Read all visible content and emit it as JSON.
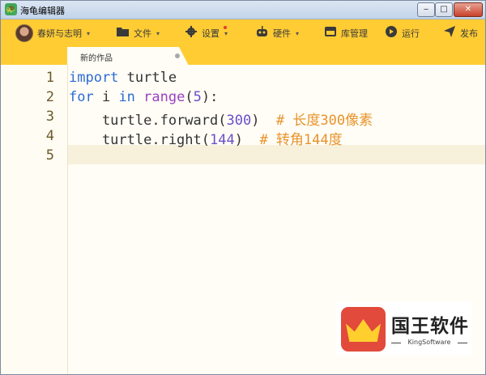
{
  "window": {
    "title": "海龟编辑器",
    "app_icon": "turtle-icon",
    "min_label": "‒",
    "max_label": "□",
    "close_label": "✕"
  },
  "toolbar": {
    "user_name": "春妍与志明",
    "file_label": "文件",
    "settings_label": "设置",
    "hardware_label": "硬件",
    "library_label": "库管理",
    "run_label": "运行",
    "publish_label": "发布",
    "caret": "▾",
    "icons": {
      "file": "folder-icon",
      "settings": "gear-icon",
      "hardware": "robot-icon",
      "library": "package-icon",
      "run": "play-icon",
      "publish": "send-icon"
    },
    "accent_color": "#ffcc33"
  },
  "tabs": [
    {
      "label": "新的作品"
    }
  ],
  "editor": {
    "line_numbers": [
      "1",
      "2",
      "3",
      "4",
      "5"
    ],
    "lines": [
      {
        "t1": "import",
        "t2": " turtle"
      },
      {
        "t1": "for",
        "t2": " i ",
        "t3": "in",
        "t4": " ",
        "t5": "range",
        "t6": "(",
        "t7": "5",
        "t8": "):"
      },
      {
        "t1": "    turtle.forward(",
        "t2": "300",
        "t3": ")  ",
        "t4": "# 长度300像素"
      },
      {
        "t1": "    turtle.right(",
        "t2": "144",
        "t3": ")  ",
        "t4": "# 转角144度"
      },
      {
        "t1": ""
      }
    ]
  },
  "watermark": {
    "name": "国王软件",
    "sub": "KingSoftware"
  }
}
